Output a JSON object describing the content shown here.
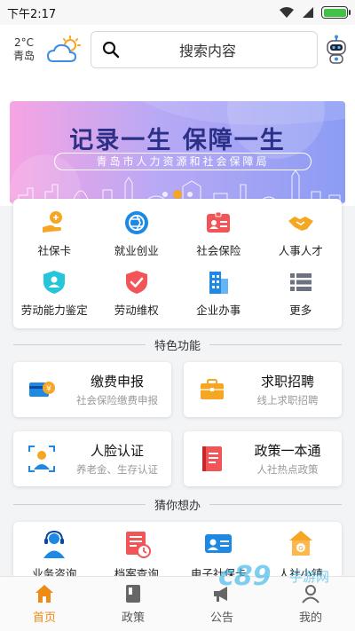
{
  "status_bar": {
    "time": "下午2:17",
    "battery_level": 1.0
  },
  "header": {
    "weather_temp": "2°C",
    "weather_city": "青岛",
    "weather_icon": "cloud-sun-icon",
    "search_placeholder": "搜索内容",
    "assistant_icon": "robot-icon"
  },
  "banner": {
    "title": "记录一生  保障一生",
    "subtitle": "青岛市人力资源和社会保障局",
    "slides": 3,
    "active_slide": 2
  },
  "services": [
    {
      "label": "社保卡",
      "icon": "hand-card-icon"
    },
    {
      "label": "就业创业",
      "icon": "aperture-icon"
    },
    {
      "label": "社会保险",
      "icon": "id-card-icon"
    },
    {
      "label": "人事人才",
      "icon": "handshake-icon"
    },
    {
      "label": "劳动能力鉴定",
      "icon": "shield-user-icon"
    },
    {
      "label": "劳动维权",
      "icon": "shield-check-icon"
    },
    {
      "label": "企业办事",
      "icon": "building-icon"
    },
    {
      "label": "更多",
      "icon": "list-icon"
    }
  ],
  "featured": {
    "title": "特色功能",
    "items": [
      {
        "title": "缴费申报",
        "subtitle": "社会保险缴费申报",
        "icon": "payment-card-icon"
      },
      {
        "title": "求职招聘",
        "subtitle": "线上求职招聘",
        "icon": "briefcase-icon"
      },
      {
        "title": "人脸认证",
        "subtitle": "养老金、生存认证",
        "icon": "face-scan-icon"
      },
      {
        "title": "政策一本通",
        "subtitle": "人社热点政策",
        "icon": "book-icon"
      }
    ]
  },
  "guess": {
    "title": "猜你想办",
    "items": [
      {
        "label": "业务咨询",
        "icon": "headset-icon"
      },
      {
        "label": "档案查询",
        "icon": "file-clock-icon"
      },
      {
        "label": "电子社保卡",
        "icon": "e-card-icon"
      },
      {
        "label": "人社小镇",
        "icon": "town-icon"
      }
    ]
  },
  "bottom_nav": [
    {
      "label": "首页",
      "icon": "home-icon",
      "active": true
    },
    {
      "label": "政策",
      "icon": "book-nav-icon",
      "active": false
    },
    {
      "label": "公告",
      "icon": "megaphone-icon",
      "active": false
    },
    {
      "label": "我的",
      "icon": "user-icon",
      "active": false
    }
  ],
  "colors": {
    "accent": "#f08a16",
    "banner_title": "#2b2f86",
    "icon_blue": "#1e88e5",
    "icon_red": "#f25557",
    "icon_orange": "#f5a623"
  }
}
